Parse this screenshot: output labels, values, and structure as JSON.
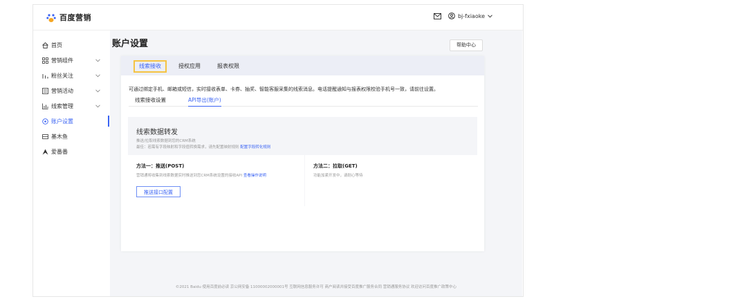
{
  "brand": {
    "name": "百度营销"
  },
  "header": {
    "user": "bj-fxiaoke"
  },
  "sidebar": {
    "items": [
      {
        "label": "首页",
        "icon": "home-icon"
      },
      {
        "label": "营销组件",
        "icon": "grid-icon",
        "chevron": true
      },
      {
        "label": "粉丝关注",
        "icon": "bar-icon",
        "chevron": true
      },
      {
        "label": "营销活动",
        "icon": "activity-icon",
        "chevron": true
      },
      {
        "label": "线索管理",
        "icon": "chart-icon",
        "chevron": true
      },
      {
        "label": "账户设置",
        "icon": "settings-icon",
        "active": true
      },
      {
        "label": "基木鱼",
        "icon": "fish-icon"
      },
      {
        "label": "爱番番",
        "icon": "aff-icon"
      }
    ]
  },
  "main": {
    "title": "账户设置",
    "help_label": "帮助中心",
    "tabs": [
      {
        "label": "线索接收",
        "active": true
      },
      {
        "label": "授权应用"
      },
      {
        "label": "报表权限"
      }
    ],
    "notice": "可通过绑定手机、邮箱或短信，实时接收表单、卡券、抽奖、智能客服采集的线索消息。电话提醒通知与报表权限校验手机号一致，请前往设置。",
    "subtabs": [
      {
        "label": "线索接收设置"
      },
      {
        "label": "API导出(账户)",
        "active": true
      }
    ],
    "section": {
      "title": "线索数据转发",
      "desc1": "推送/拉取线索数据到您的CRM系统",
      "desc2": "最佳：若需有字段映射和字段值转换需求，请先配置映射规则",
      "desc2_link": "配置字段转化规则"
    },
    "method1": {
      "title": "方法一：推送(POST)",
      "desc": "营销通将收集到线索数据实时推送到您CRM系统设置的接收API",
      "desc_link": "查看操作说明",
      "button": "推送接口配置"
    },
    "method2": {
      "title": "方法二：拉取(GET)",
      "desc": "功能加紧开发中，请耐心等待"
    }
  },
  "footer": {
    "text": "©2021 Baidu 使用百度前必读 京公网安备 11000002000001号 互联网信息服务许可 商户阅读并接受百度推广服务合同 营销通服务协议 欢迎访问百度推广政策中心"
  },
  "colors": {
    "accent": "#3a63f3",
    "tab_highlight": "#f5c342"
  }
}
